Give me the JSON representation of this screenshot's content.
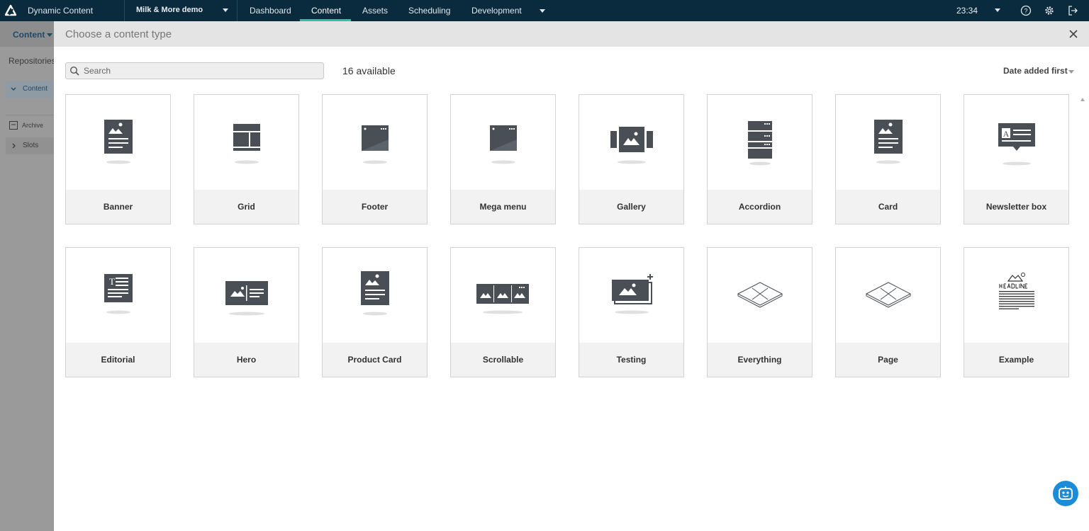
{
  "topbar": {
    "app_name": "Dynamic Content",
    "hub_name": "Milk & More demo",
    "tabs": [
      {
        "label": "Dashboard",
        "active": false
      },
      {
        "label": "Content",
        "active": true
      },
      {
        "label": "Assets",
        "active": false
      },
      {
        "label": "Scheduling",
        "active": false
      },
      {
        "label": "Development",
        "active": false
      }
    ],
    "time": "23:34",
    "accent_color": "#2ec4a3",
    "background_color": "#0a2a3d",
    "icons": [
      "amplience-logo-icon",
      "help-icon",
      "settings-gear-icon",
      "logout-icon"
    ]
  },
  "sidebar": {
    "dropdown_label": "Content",
    "section_title": "Repositories",
    "items": [
      {
        "label": "Content",
        "icon": "chevron-down-icon"
      },
      {
        "label": "Archive",
        "icon": "archive-icon"
      },
      {
        "label": "Slots",
        "icon": "chevron-right-icon"
      }
    ]
  },
  "modal": {
    "title": "Choose a content type",
    "search_placeholder": "Search",
    "search_value": "",
    "count_label": "16 available",
    "sort_label": "Date added first",
    "content_types": [
      {
        "label": "Banner",
        "icon": "banner-icon"
      },
      {
        "label": "Grid",
        "icon": "grid-icon"
      },
      {
        "label": "Footer",
        "icon": "footer-icon"
      },
      {
        "label": "Mega menu",
        "icon": "mega-menu-icon"
      },
      {
        "label": "Gallery",
        "icon": "gallery-icon"
      },
      {
        "label": "Accordion",
        "icon": "accordion-icon"
      },
      {
        "label": "Card",
        "icon": "card-icon"
      },
      {
        "label": "Newsletter box",
        "icon": "newsletter-icon"
      },
      {
        "label": "Editorial",
        "icon": "editorial-icon"
      },
      {
        "label": "Hero",
        "icon": "hero-icon"
      },
      {
        "label": "Product Card",
        "icon": "product-card-icon"
      },
      {
        "label": "Scrollable",
        "icon": "scrollable-icon"
      },
      {
        "label": "Testing",
        "icon": "testing-icon"
      },
      {
        "label": "Everything",
        "icon": "placeholder-icon"
      },
      {
        "label": "Page",
        "icon": "placeholder-icon"
      },
      {
        "label": "Example",
        "icon": "headline-icon"
      }
    ]
  },
  "chatbot": {
    "icon": "chatbot-icon",
    "color": "#1a8cd8"
  }
}
